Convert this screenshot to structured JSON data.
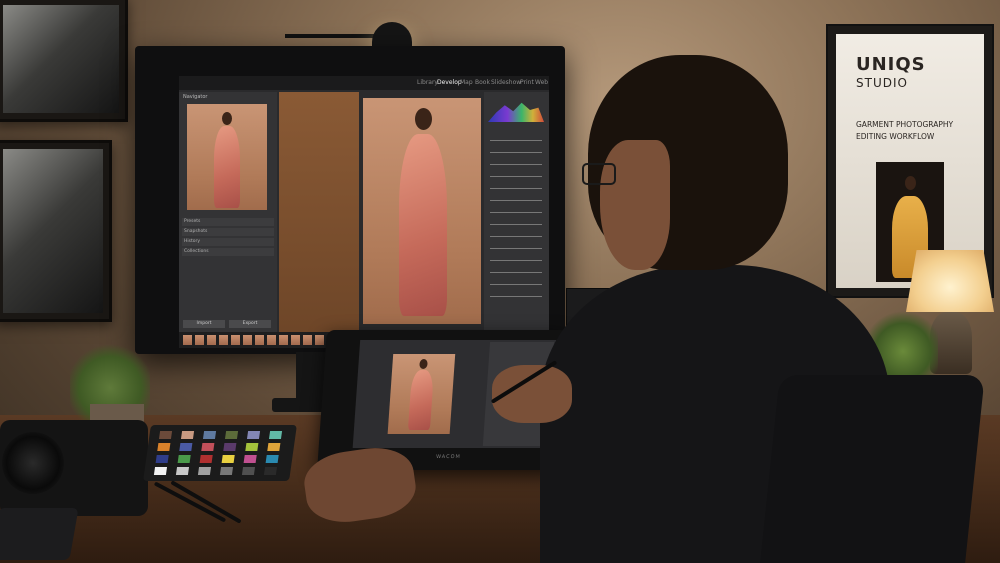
{
  "scene": {
    "description_colors": {
      "wall": "#8c7257",
      "desk": "#4a2f1c",
      "shirt": "#151517",
      "lamp_glow": "#f3cf8f"
    }
  },
  "monitor_app": {
    "modules": [
      "Library",
      "Develop",
      "Map",
      "Book",
      "Slideshow",
      "Print",
      "Web"
    ],
    "active_module": "Develop",
    "left_panel": {
      "navigator_label": "Navigator",
      "sections": [
        "Presets",
        "Snapshots",
        "History",
        "Collections"
      ],
      "buttons": [
        "Import",
        "Export"
      ]
    },
    "icons": [
      "histogram-icon",
      "filmstrip-icon"
    ]
  },
  "tablet": {
    "brand": "WACOM"
  },
  "poster": {
    "brand_line1": "UNIQS",
    "brand_line2": "STUDIO",
    "subtitle_line1": "GARMENT PHOTOGRAPHY",
    "subtitle_line2": "EDITING WORKFLOW"
  },
  "color_checker": {
    "swatches": [
      "#6b4a3a",
      "#c89a82",
      "#5f7aa0",
      "#5c6b3a",
      "#8387b5",
      "#62b8a6",
      "#d9822b",
      "#4a5aa5",
      "#c2505a",
      "#5a3a6a",
      "#a4c23c",
      "#e0a53a",
      "#2f3d8a",
      "#4a9a4a",
      "#b03030",
      "#e8d040",
      "#c05090",
      "#2a8ab0",
      "#f2f2f2",
      "#c8c8c8",
      "#a0a0a0",
      "#787878",
      "#505050",
      "#2a2a2a"
    ]
  }
}
